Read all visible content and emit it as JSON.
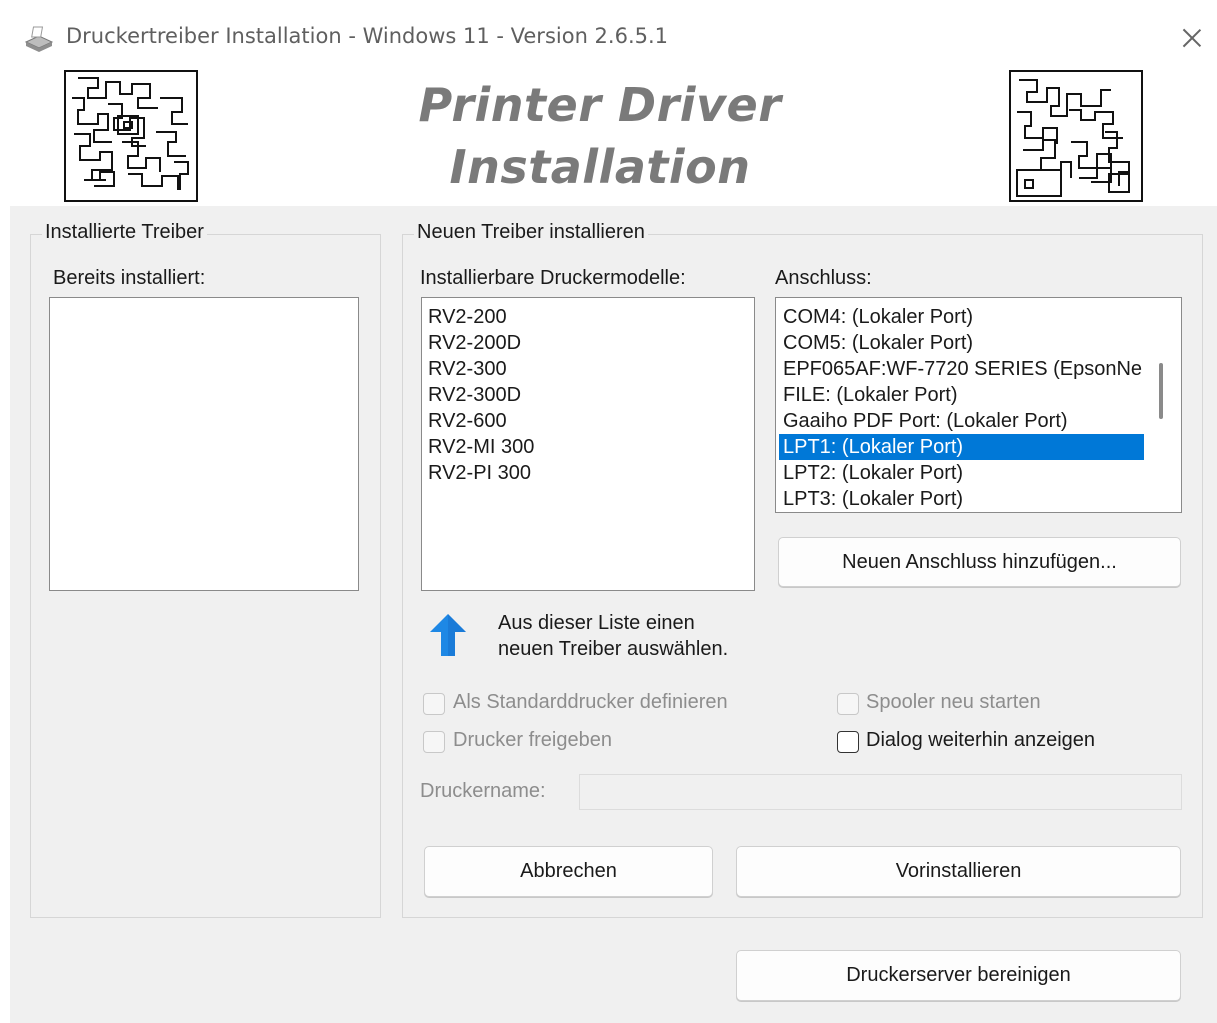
{
  "window": {
    "title": "Druckertreiber Installation - Windows 11 - Version 2.6.5.1"
  },
  "header": {
    "logo_line1": "Printer Driver",
    "logo_line2": "Installation"
  },
  "installed_group": {
    "title": "Installierte Treiber",
    "list_label": "Bereits installiert:",
    "items": []
  },
  "new_group": {
    "title": "Neuen Treiber installieren",
    "models_label": "Installierbare Druckermodelle:",
    "models": [
      "RV2-200",
      "RV2-200D",
      "RV2-300",
      "RV2-300D",
      "RV2-600",
      "RV2-MI 300",
      "RV2-PI 300"
    ],
    "port_label": "Anschluss:",
    "ports": [
      "COM4: (Lokaler Port)",
      "COM5: (Lokaler Port)",
      "EPF065AF:WF-7720 SERIES (EpsonNe",
      "FILE: (Lokaler Port)",
      "Gaaiho PDF Port: (Lokaler Port)",
      "LPT1: (Lokaler Port)",
      "LPT2: (Lokaler Port)",
      "LPT3: (Lokaler Port)"
    ],
    "selected_port": "LPT1: (Lokaler Port)",
    "add_port_button": "Neuen Anschluss hinzufügen...",
    "hint_line1": "Aus dieser Liste einen",
    "hint_line2": "neuen Treiber auswählen.",
    "checkboxes": {
      "set_default": "Als Standarddrucker definieren",
      "share": "Drucker freigeben",
      "restart_spooler": "Spooler neu starten",
      "show_dialog": "Dialog weiterhin anzeigen"
    },
    "printer_name_label": "Druckername:",
    "printer_name_value": "",
    "cancel_button": "Abbrechen",
    "preinstall_button": "Vorinstallieren"
  },
  "footer": {
    "clean_server_button": "Druckerserver bereinigen"
  },
  "colors": {
    "selection": "#0078d7",
    "hint_arrow": "#1e88e5"
  },
  "icons": {
    "app": "printer-icon",
    "close": "close-icon",
    "hint": "arrow-up-icon"
  }
}
